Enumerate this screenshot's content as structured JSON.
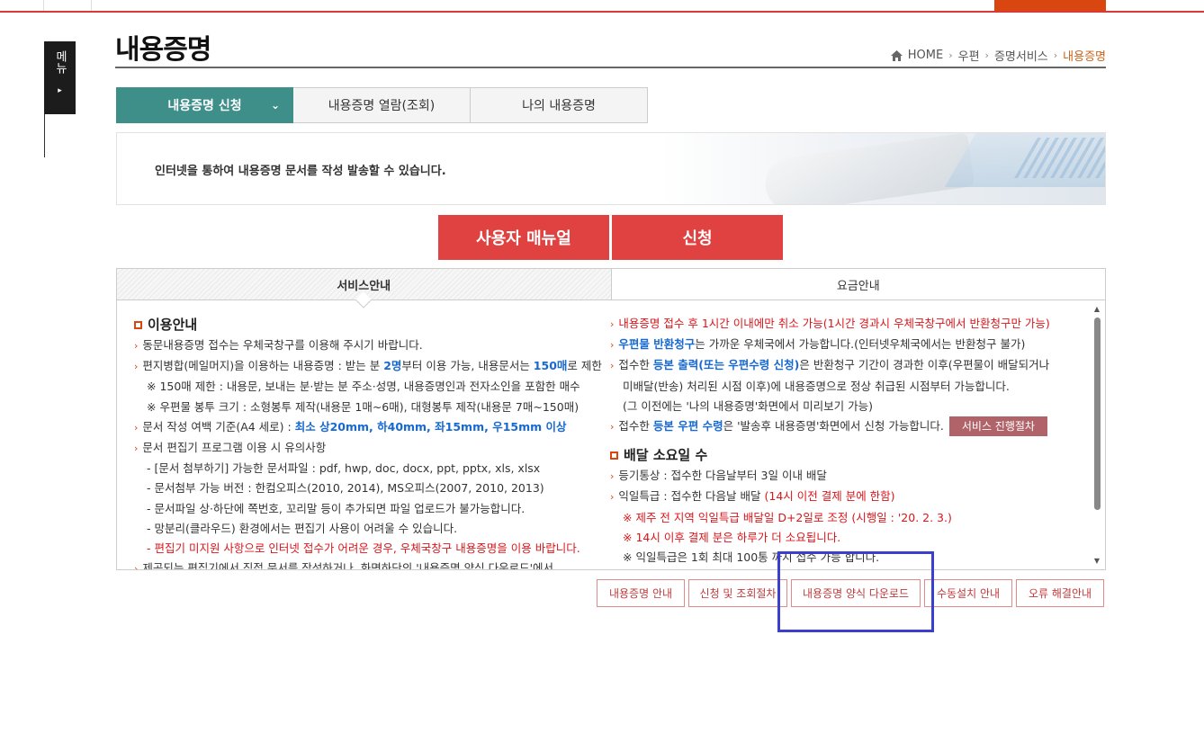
{
  "side_menu": {
    "label": "메뉴",
    "arrow": "▸"
  },
  "page": {
    "title": "내용증명"
  },
  "breadcrumb": {
    "home": "HOME",
    "items": [
      "우편",
      "증명서비스"
    ],
    "current": "내용증명",
    "sep": "›"
  },
  "tabs": [
    {
      "label": "내용증명 신청",
      "chevron": "⌄"
    },
    {
      "label": "내용증명 열람(조회)"
    },
    {
      "label": "나의 내용증명"
    }
  ],
  "banner": {
    "text": "인터넷을 통하여 내용증명 문서를 작성 발송할 수 있습니다."
  },
  "buttons": {
    "manual": "사용자 매뉴얼",
    "apply": "신청"
  },
  "panel": {
    "tabs": [
      "서비스안내",
      "요금안내"
    ],
    "left": {
      "title": "이용안내",
      "l1": "동문내용증명 접수는 우체국창구를 이용해 주시기 바랍니다.",
      "l2a": "편지병합(메일머지)을 이용하는 내용증명 : 받는 분 ",
      "l2b": "2명",
      "l2c": "부터 이용 가능, 내용문서는 ",
      "l2d": "150매",
      "l2e": "로 제한",
      "l3": "※ 150매 제한 : 내용문, 보내는 분·받는 분 주소·성명, 내용증명인과 전자소인을 포함한 매수",
      "l4": "※ 우편물 봉투 크기 : 소형봉투 제작(내용문 1매~6매), 대형봉투 제작(내용문 7매~150매)",
      "l5a": "문서 작성 여백 기준(A4 세로) : ",
      "l5b": "최소 상20mm, 하40mm, 좌15mm, 우15mm 이상",
      "l6": "문서 편집기 프로그램 이용 시 유의사항",
      "l7": "- [문서 첨부하기] 가능한 문서파일 : pdf, hwp, doc, docx, ppt, pptx, xls, xlsx",
      "l8": "- 문서첨부 가능 버전 : 한컴오피스(2010, 2014), MS오피스(2007, 2010, 2013)",
      "l9": "- 문서파일 상·하단에 쪽번호, 꼬리말 등이 추가되면 파일 업로드가 불가능합니다.",
      "l10": "- 망분리(클라우드) 환경에서는 편집기 사용이 어려울 수 있습니다.",
      "l11": "- 편집기 미지원 사항으로 인터넷 접수가 어려운 경우, 우체국창구 내용증명을 이용 바랍니다.",
      "l12": "제공되는 편집기에서 직접 문서를 작성하거나, 화면하단의 '내용증명 양식 다운로드'에서"
    },
    "right": {
      "r1": "내용증명 접수 후 1시간 이내에만 취소 가능(1시간 경과시 우체국창구에서 반환청구만 가능)",
      "r2a": "우편물 반환청구",
      "r2b": "는 가까운 우체국에서 가능합니다.(인터넷우체국에서는 반환청구 불가)",
      "r3a": "접수한 ",
      "r3b": "등본 출력(또는 우편수령 신청)",
      "r3c": "은 반환청구 기간이 경과한 이후(우편물이 배달되거나",
      "r4": "미배달(반송) 처리된 시점 이후)에 내용증명으로 정상 취급된 시점부터 가능합니다.",
      "r5": "(그 이전에는 '나의 내용증명'화면에서 미리보기 가능)",
      "r6a": "접수한 ",
      "r6b": "등본 우편 수령",
      "r6c": "은 '발송후 내용증명'화면에서 신청 가능합니다.",
      "process_btn": "서비스 진행절차",
      "title2": "배달 소요일 수",
      "d1": "등기통상 : 접수한 다음날부터 3일 이내 배달",
      "d2a": "익일특급 : 접수한 다음날 배달 ",
      "d2b": "(14시 이전 결제 분에 한함)",
      "d3": "※ 제주 전 지역 익일특급 배달일 D+2일로 조정 (시행일 : '20. 2. 3.)",
      "d4": "※ 14시 이후 결제 분은 하루가 더 소요됩니다.",
      "d5": "※ 익일특급은 1회 최대 100통 까지 접수 가능 합니다."
    }
  },
  "bottom_links": [
    "내용증명 안내",
    "신청 및 조회절차",
    "내용증명 양식 다운로드",
    "수동설치 안내",
    "오류 해결안내"
  ],
  "colors": {
    "accent_red": "#e04141",
    "teal": "#3e8f8a",
    "orange": "#d9460f",
    "highlight": "#3a3fd0"
  }
}
